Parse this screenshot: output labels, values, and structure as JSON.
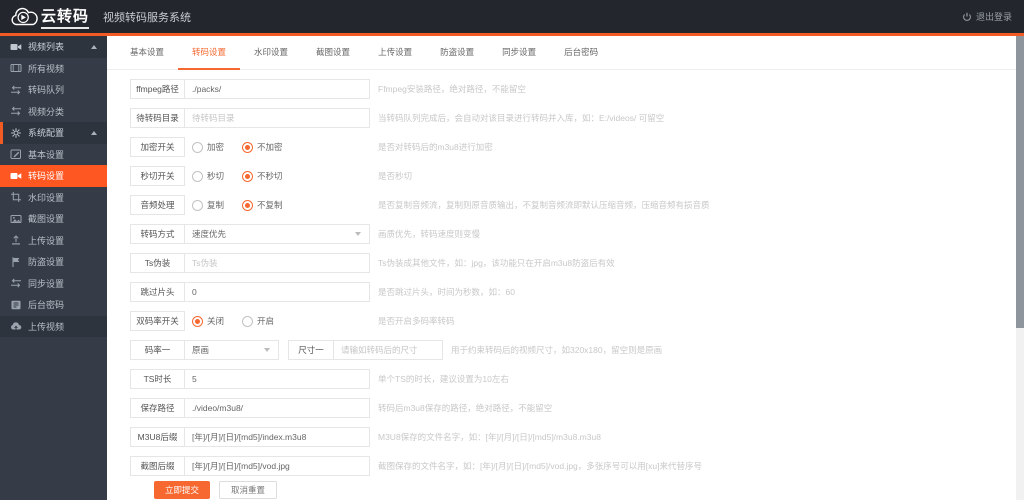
{
  "topbar": {
    "logo_text": "云转码",
    "title": "视频转码服务系统",
    "logout_label": "退出登录"
  },
  "colors": {
    "accent_line": "#f25b24",
    "sidebar_active": "#ff5722",
    "button_primary": "#f6682f",
    "topbar_bg": "#23262d",
    "sidebar_bg": "#353c47"
  },
  "sidebar": {
    "items": [
      {
        "label": "视频列表",
        "icon": "video-camera-icon",
        "style": "parent",
        "expanded": true
      },
      {
        "label": "所有视频",
        "icon": "film-icon",
        "style": "child"
      },
      {
        "label": "转码队列",
        "icon": "swap-arrows-icon",
        "style": "child"
      },
      {
        "label": "视频分类",
        "icon": "swap-arrows-icon",
        "style": "child"
      },
      {
        "label": "系统配置",
        "icon": "gear-icon",
        "style": "parent",
        "expanded": true,
        "accent_border": true
      },
      {
        "label": "基本设置",
        "icon": "edit-icon",
        "style": "child"
      },
      {
        "label": "转码设置",
        "icon": "camera-icon",
        "style": "child",
        "active": true
      },
      {
        "label": "水印设置",
        "icon": "watermark-icon",
        "style": "child"
      },
      {
        "label": "截图设置",
        "icon": "image-icon",
        "style": "child"
      },
      {
        "label": "上传设置",
        "icon": "upload-icon",
        "style": "child"
      },
      {
        "label": "防盗设置",
        "icon": "flag-icon",
        "style": "child"
      },
      {
        "label": "同步设置",
        "icon": "swap-arrows-icon",
        "style": "child"
      },
      {
        "label": "后台密码",
        "icon": "id-card-icon",
        "style": "child"
      },
      {
        "label": "上传视频",
        "icon": "cloud-upload-icon",
        "style": "section"
      }
    ]
  },
  "tabs": {
    "items": [
      "基本设置",
      "转码设置",
      "水印设置",
      "截图设置",
      "上传设置",
      "防盗设置",
      "同步设置",
      "后台密码"
    ],
    "active_index": 1
  },
  "form": {
    "rows": [
      {
        "type": "input",
        "label": "ffmpeg路径",
        "value": "./packs/",
        "help": "Ffmpeg安装路径，绝对路径，不能留空"
      },
      {
        "type": "input",
        "label": "待转码目录",
        "placeholder": "待转码目录",
        "help": "当转码队列完成后，会自动对该目录进行转码并入库，如：E:/videos/ 可留空"
      },
      {
        "type": "radio",
        "label": "加密开关",
        "options": [
          "加密",
          "不加密"
        ],
        "selected": 1,
        "help": "是否对转码后的m3u8进行加密"
      },
      {
        "type": "radio",
        "label": "秒切开关",
        "options": [
          "秒切",
          "不秒切"
        ],
        "selected": 1,
        "help": "是否秒切"
      },
      {
        "type": "radio",
        "label": "音频处理",
        "options": [
          "复制",
          "不复制"
        ],
        "selected": 1,
        "help": "是否复制音频流，复制则原音质输出，不复制音频流即默认压缩音频，压缩音频有损音质"
      },
      {
        "type": "select",
        "label": "转码方式",
        "value": "速度优先",
        "help": "画质优先，转码速度则变慢"
      },
      {
        "type": "input",
        "label": "Ts伪装",
        "placeholder": "Ts伪装",
        "help": "Ts伪装成其他文件，如：jpg，该功能只在开启m3u8防盗后有效"
      },
      {
        "type": "input",
        "label": "跳过片头",
        "value": "0",
        "help": "是否跳过片头，时间为秒数，如：60"
      },
      {
        "type": "radio",
        "label": "双码率开关",
        "options": [
          "关闭",
          "开启"
        ],
        "selected": 0,
        "help": "是否开启多码率转码"
      },
      {
        "type": "select-input",
        "label": "码率一",
        "select_value": "原画",
        "label2": "尺寸一",
        "placeholder2": "请输如转码后的尺寸",
        "help": "用于约束转码后的视频尺寸，如320x180，留空则是原画"
      },
      {
        "type": "input",
        "label": "TS时长",
        "value": "5",
        "help": "单个TS的时长，建议设置为10左右"
      },
      {
        "type": "input",
        "label": "保存路径",
        "value": "./video/m3u8/",
        "help": "转码后m3u8保存的路径，绝对路径，不能留空"
      },
      {
        "type": "input",
        "label": "M3U8后缀",
        "value": "[年]/[月]/[日]/[md5]/index.m3u8",
        "help": "M3U8保存的文件名字，如：[年]/[月]/[日]/[md5]/m3u8.m3u8"
      },
      {
        "type": "input",
        "label": "截图后缀",
        "value": "[年]/[月]/[日]/[md5]/vod.jpg",
        "help": "截图保存的文件名字，如：[年]/[月]/[日]/[md5]/vod.jpg，多张序号可以用[xu]来代替序号"
      }
    ],
    "submit_label": "立即提交",
    "reset_label": "取消重置"
  }
}
